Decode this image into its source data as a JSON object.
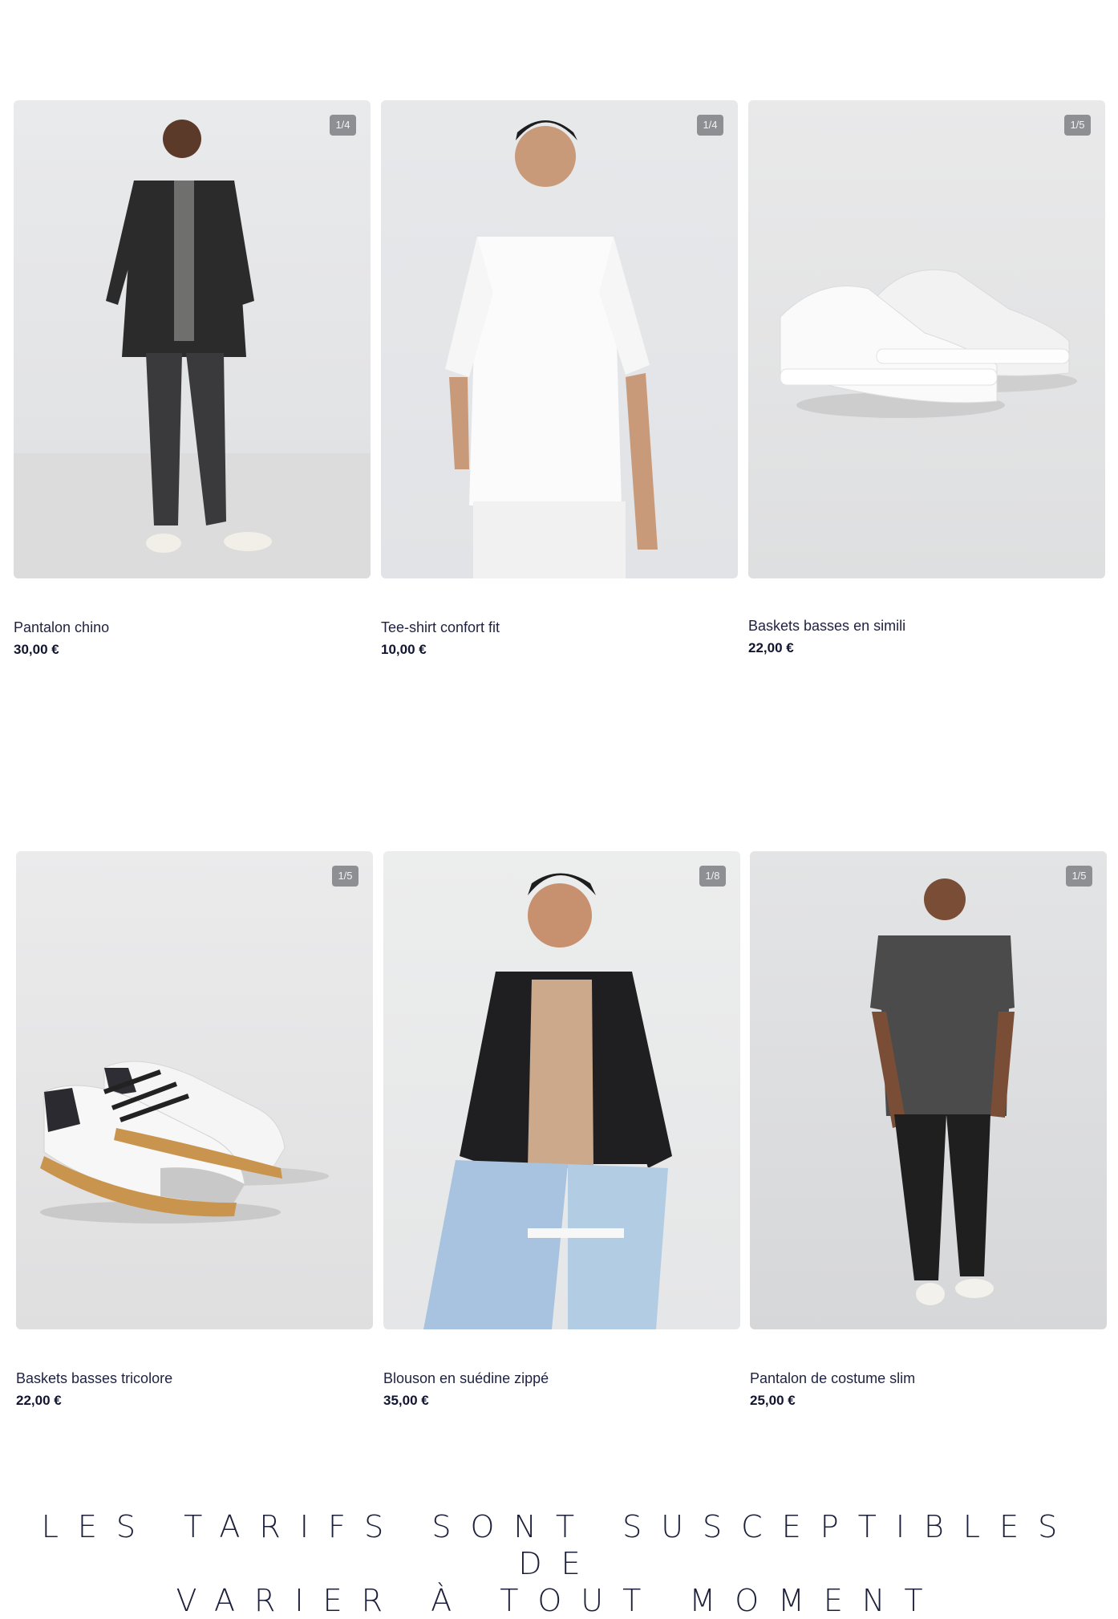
{
  "products": [
    {
      "name": "Pantalon chino",
      "price": "30,00 €",
      "badge": "1/4",
      "image": "man-dark-shirt-chino"
    },
    {
      "name": "Tee-shirt confort fit",
      "price": "10,00 €",
      "badge": "1/4",
      "image": "man-white-tshirt"
    },
    {
      "name": "Baskets basses en simili",
      "price": "22,00 €",
      "badge": "1/5",
      "image": "white-sneakers"
    },
    {
      "name": "Baskets basses tricolore",
      "price": "22,00 €",
      "badge": "1/5",
      "image": "tricolor-sneakers"
    },
    {
      "name": "Blouson en suédine zippé",
      "price": "35,00 €",
      "badge": "1/8",
      "image": "man-suede-jacket"
    },
    {
      "name": "Pantalon de costume slim",
      "price": "25,00 €",
      "badge": "1/5",
      "image": "man-grey-tshirt-slim-pants"
    }
  ],
  "footer": {
    "line1": "LES TARIFS SONT SUSCEPTIBLES DE",
    "line2": "VARIER À TOUT MOMENT"
  }
}
